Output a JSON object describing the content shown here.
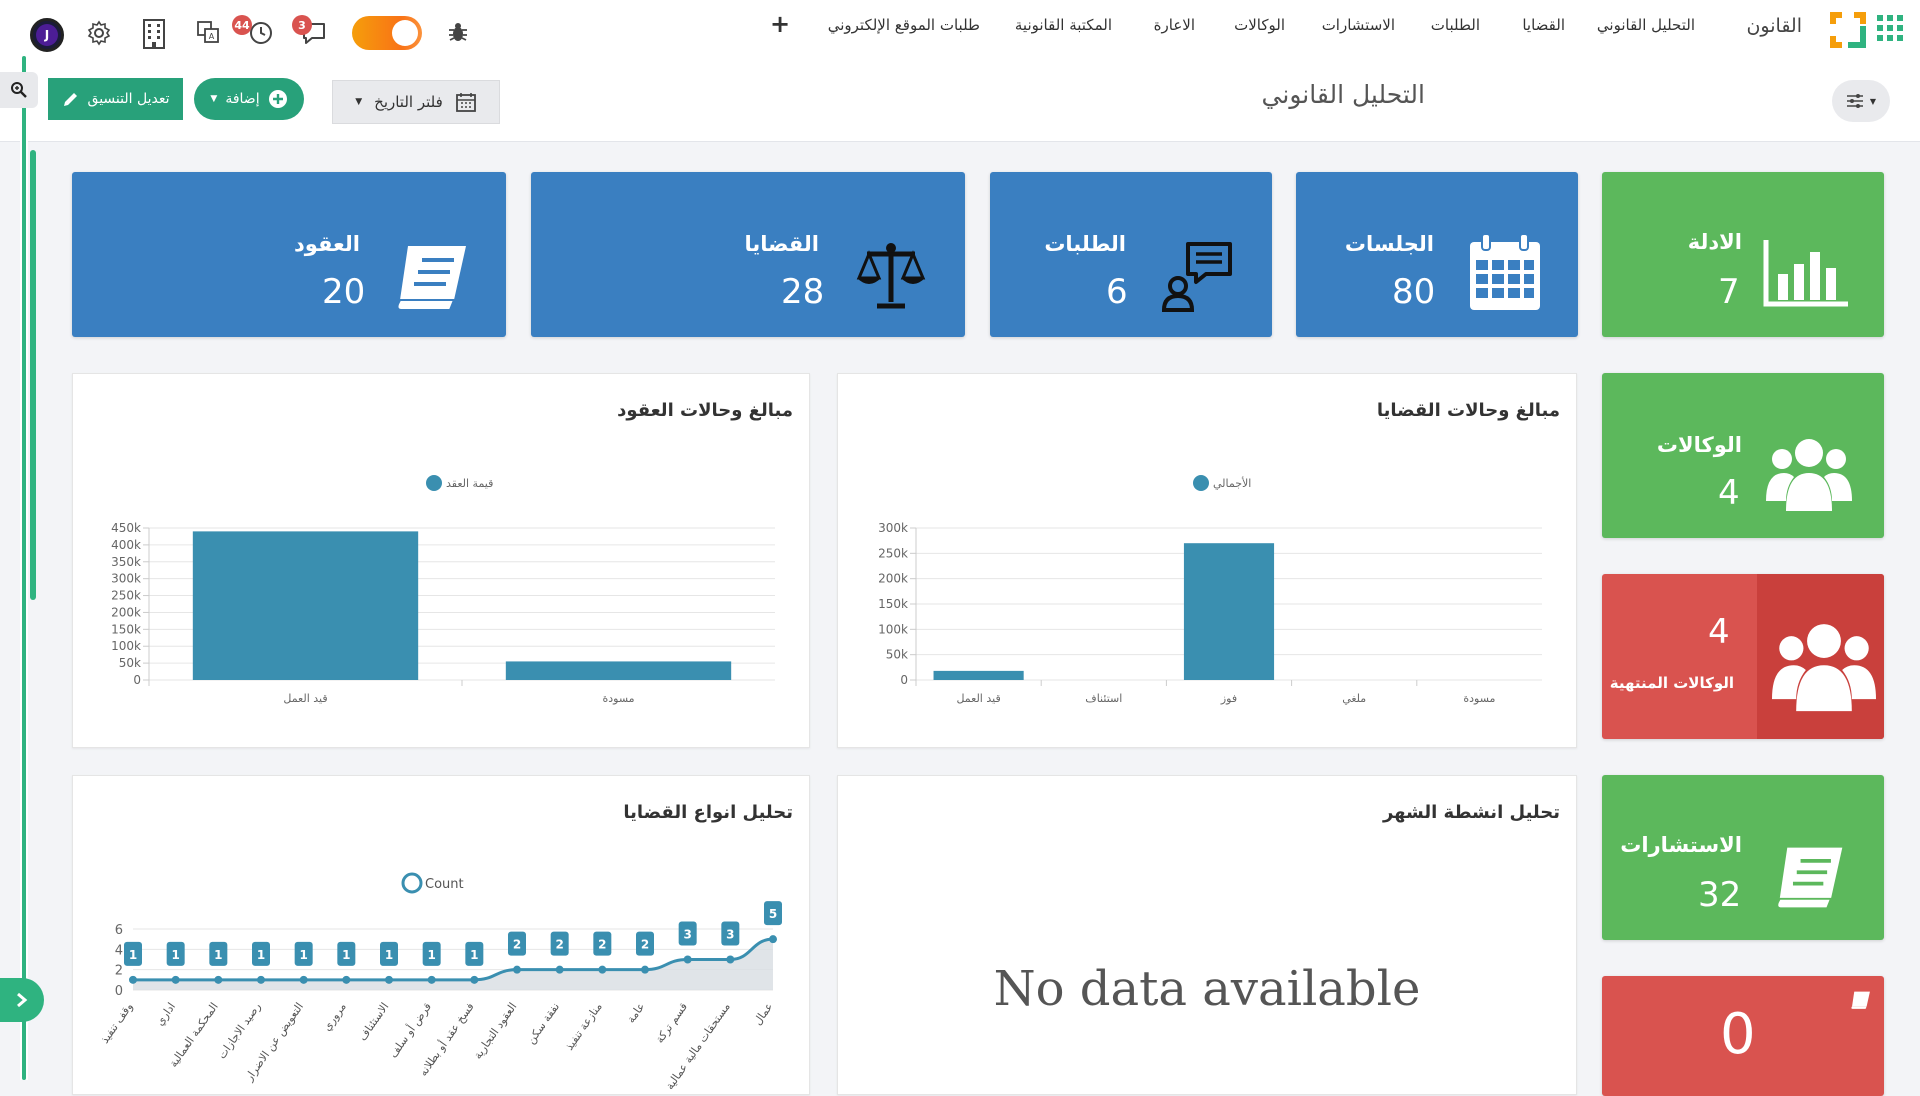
{
  "nav": {
    "brand": "القانون",
    "items": [
      "التحليل القانوني",
      "القضايا",
      "الطلبات",
      "الاستشارات",
      "الوكالات",
      "الاعارة",
      "المكتبة القانونية",
      "طلبات الموقع الإلكتروني"
    ],
    "plus": "+"
  },
  "toolbar": {
    "avatar_letter": "J",
    "notifications_count": "44",
    "messages_count": "3",
    "icons": [
      "avatar",
      "gear-icon",
      "building-icon",
      "translate-icon",
      "clock-icon",
      "chat-icon",
      "theme-toggle",
      "bug-icon"
    ]
  },
  "subheader": {
    "title": "التحليل القانوني",
    "edit_layout_label": "تعديل التنسيق",
    "add_label": "إضافة",
    "date_filter_label": "فلتر التاريخ"
  },
  "colors": {
    "blue": "#3a7fc1",
    "green": "#5cb85c",
    "red": "#d9534f",
    "accent": "#2fb380",
    "bar": "#3a8fb0"
  },
  "stats": {
    "contracts": {
      "title": "العقود",
      "value": "20",
      "icon": "book-icon"
    },
    "cases": {
      "title": "القضايا",
      "value": "28",
      "icon": "scales-icon"
    },
    "requests": {
      "title": "الطلبات",
      "value": "6",
      "icon": "user-chat-icon"
    },
    "sessions": {
      "title": "الجلسات",
      "value": "80",
      "icon": "calendar-icon"
    },
    "evidence": {
      "title": "الادلة",
      "value": "7",
      "icon": "bar-chart-icon"
    },
    "agencies": {
      "title": "الوكالات",
      "value": "4",
      "icon": "users-icon"
    },
    "expired_agencies": {
      "title": "الوكالات المنتهية",
      "value": "4",
      "icon": "users-icon"
    },
    "consultations": {
      "title": "الاستشارات",
      "value": "32",
      "icon": "book-icon"
    },
    "extra": {
      "value": "0",
      "icon": "book-icon"
    }
  },
  "panels": {
    "contracts_chart_title": "مبالغ وحالات العقود",
    "cases_chart_title": "مبالغ وحالات القضايا",
    "case_types_title": "تحليل انواع القضايا",
    "month_activity_title": "تحليل انشطة الشهر",
    "no_data": "No data available"
  },
  "chart_data": [
    {
      "type": "bar",
      "title": "مبالغ وحالات العقود",
      "categories": [
        "قيد العمل",
        "مسودة"
      ],
      "series": [
        {
          "name": "قيمة العقد",
          "values": [
            440000,
            55000
          ]
        }
      ],
      "ylim": [
        0,
        450000
      ],
      "yticks": [
        "0",
        "50k",
        "100k",
        "150k",
        "200k",
        "250k",
        "300k",
        "350k",
        "400k",
        "450k"
      ],
      "legend": "top-center",
      "grid": true
    },
    {
      "type": "bar",
      "title": "مبالغ وحالات القضايا",
      "categories": [
        "قيد العمل",
        "استئناف",
        "فوز",
        "ملغي",
        "مسودة"
      ],
      "series": [
        {
          "name": "الأجمالي",
          "values": [
            18000,
            0,
            270000,
            0,
            0
          ]
        }
      ],
      "ylim": [
        0,
        300000
      ],
      "yticks": [
        "0",
        "50k",
        "100k",
        "150k",
        "200k",
        "250k",
        "300k"
      ],
      "legend": "top-center",
      "grid": true
    },
    {
      "type": "area",
      "title": "تحليل انواع القضايا",
      "categories": [
        "وقف تنفيذ",
        "اداري",
        "المحكمة العمالية",
        "رصيد الاجازات",
        "التعويض عن الاضرار",
        "مروري",
        "الاستئناف",
        "قرض أو سلف",
        "فسخ عقد أو بطلانه",
        "العقود التجارية",
        "نفقة سكن",
        "منازعة تنفيذ",
        "عامة",
        "قسم تركة",
        "مستحقات مالية عمالية",
        "عمال"
      ],
      "series": [
        {
          "name": "Count",
          "values": [
            1,
            1,
            1,
            1,
            1,
            1,
            1,
            1,
            1,
            2,
            2,
            2,
            2,
            3,
            3,
            5
          ]
        }
      ],
      "ylim": [
        0,
        6
      ],
      "yticks": [
        "0",
        "2",
        "4",
        "6"
      ],
      "legend": "top-center",
      "grid": true
    }
  ]
}
